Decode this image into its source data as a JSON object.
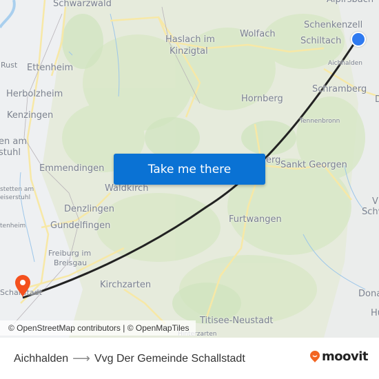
{
  "map": {
    "place_labels": [
      {
        "name": "Schwarzwald",
        "size": "lg"
      },
      {
        "name": "Haslach im",
        "size": "lg"
      },
      {
        "name": "Kinzigtal",
        "size": "lg"
      },
      {
        "name": "Wolfach",
        "size": "lg"
      },
      {
        "name": "Schenkenzell",
        "size": "lg"
      },
      {
        "name": "Schiltach",
        "size": "lg"
      },
      {
        "name": "Aichhalden",
        "size": "sm"
      },
      {
        "name": "Schramberg",
        "size": "lg"
      },
      {
        "name": "Hornberg",
        "size": "lg"
      },
      {
        "name": "Tennenbronn",
        "size": "sm"
      },
      {
        "name": "Rust",
        "size": "md"
      },
      {
        "name": "Ettenheim",
        "size": "lg"
      },
      {
        "name": "Herbolzheim",
        "size": "lg"
      },
      {
        "name": "Kenzingen",
        "size": "lg"
      },
      {
        "name": "en am",
        "size": "lg"
      },
      {
        "name": "stuhl",
        "size": "lg"
      },
      {
        "name": "Emmendingen",
        "size": "lg"
      },
      {
        "name": "stetten am",
        "size": "sm"
      },
      {
        "name": "eiserstuhl",
        "size": "sm"
      },
      {
        "name": "Waldkirch",
        "size": "lg"
      },
      {
        "name": "Denzlingen",
        "size": "lg"
      },
      {
        "name": "tenheim",
        "size": "sm"
      },
      {
        "name": "Gundelfingen",
        "size": "lg"
      },
      {
        "name": "Freiburg im",
        "size": "md"
      },
      {
        "name": "Breisgau",
        "size": "md"
      },
      {
        "name": "Schallstadt",
        "size": "md"
      },
      {
        "name": "Kirchzarten",
        "size": "lg"
      },
      {
        "name": "Sankt Georgen",
        "size": "lg"
      },
      {
        "name": "erg",
        "size": "lg"
      },
      {
        "name": "Furtwangen",
        "size": "lg"
      },
      {
        "name": "Titisee-Neustadt",
        "size": "lg"
      },
      {
        "name": "Hinterzarten",
        "size": "sm"
      },
      {
        "name": "Schw",
        "size": "lg"
      },
      {
        "name": "Dona",
        "size": "lg"
      },
      {
        "name": "Hu",
        "size": "lg"
      },
      {
        "name": "Alpirsbach",
        "size": "lg"
      },
      {
        "name": "D",
        "size": "lg"
      },
      {
        "name": "V",
        "size": "lg"
      }
    ],
    "cta_label": "Take me there",
    "attribution": "© OpenStreetMap contributors | © OpenMapTiles",
    "origin_marker": {
      "name": "Aichhalden",
      "color": "#2f7af0"
    },
    "destination_marker": {
      "name": "Vvg Der Gemeinde Schallstadt",
      "color": "#f4511e"
    },
    "route_color": "#222222"
  },
  "footer": {
    "origin": "Aichhalden",
    "arrow": "⟶",
    "destination": "Vvg Der Gemeinde Schallstadt",
    "brand": "moovit",
    "brand_color": "#f26522"
  }
}
